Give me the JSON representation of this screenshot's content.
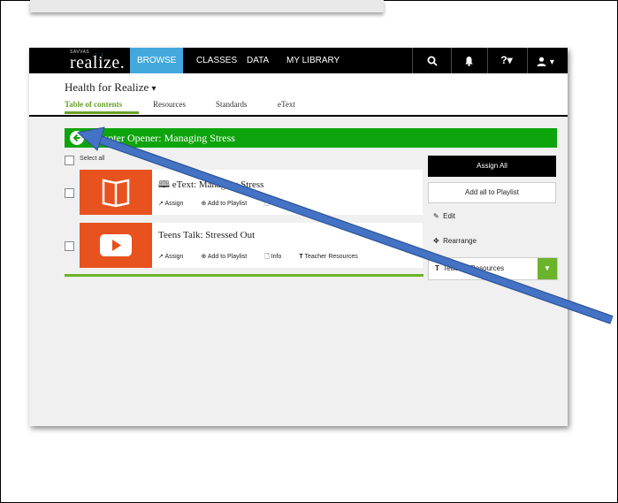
{
  "brand": {
    "small_text": "SAVVAS",
    "name": "realize."
  },
  "nav": {
    "items": [
      {
        "label": "BROWSE",
        "active": true
      },
      {
        "label": "CLASSES",
        "active": false
      },
      {
        "label": "DATA",
        "active": false
      },
      {
        "label": "MY LIBRARY",
        "active": false
      }
    ],
    "icons": [
      "search-icon",
      "bell-icon",
      "help-icon",
      "user-icon"
    ],
    "help_glyph": "?▾",
    "user_glyph": "▾"
  },
  "header": {
    "course_title": "Health for Realize",
    "course_caret": "▾",
    "tabs": [
      {
        "label": "Table of contents",
        "active": true
      },
      {
        "label": "Resources",
        "active": false
      },
      {
        "label": "Standards",
        "active": false
      },
      {
        "label": "eText",
        "active": false
      }
    ]
  },
  "chapter": {
    "title": "Chapter Opener: Managing Stress",
    "back_glyph": "❮"
  },
  "list": {
    "select_all_label": "Select all",
    "items": [
      {
        "title": "eText: Managing Stress",
        "title_icon": "book-icon",
        "actions": [
          "Assign",
          "Add to Playlist",
          "Info"
        ]
      },
      {
        "title": "Teens Talk: Stressed Out",
        "actions": [
          "Assign",
          "Add to Playlist",
          "Info",
          "Teacher Resources"
        ]
      }
    ]
  },
  "sidebar": {
    "assign_all": "Assign All",
    "add_all_playlist": "Add all to Playlist",
    "edit": "Edit",
    "rearrange": "Rearrange",
    "teacher_resources": "Teacher Resources"
  },
  "colors": {
    "nav_bg": "#000000",
    "nav_active": "#43a8dc",
    "chapter_green": "#0ea40e",
    "accent_green": "#6bb32a",
    "thumb_orange": "#e8521f",
    "arrow_blue": "#4472c4"
  }
}
